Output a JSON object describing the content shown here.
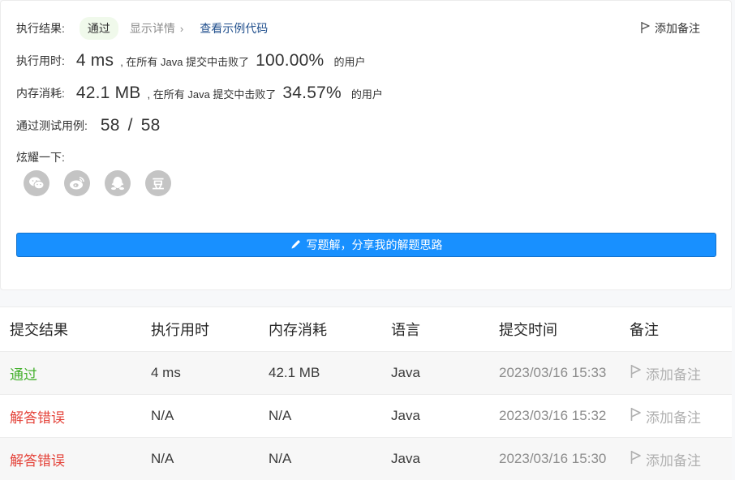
{
  "result": {
    "label": "执行结果:",
    "status": "通过",
    "details_link": "显示详情",
    "details_chevron": "›",
    "example_link": "查看示例代码",
    "add_note": "添加备注"
  },
  "runtime": {
    "label": "执行用时:",
    "value": "4 ms",
    "mid_text": ", 在所有 Java 提交中击败了",
    "percent": "100.00%",
    "suffix": "的用户"
  },
  "memory": {
    "label": "内存消耗:",
    "value": "42.1 MB",
    "mid_text": ", 在所有 Java 提交中击败了",
    "percent": "34.57%",
    "suffix": "的用户"
  },
  "tests": {
    "label": "通过测试用例:",
    "passed": "58",
    "separator": "/",
    "total": "58"
  },
  "share": {
    "label": "炫耀一下:",
    "icons": [
      "wechat-icon",
      "weibo-icon",
      "qq-icon",
      "douban-icon"
    ],
    "douban_glyph": "豆"
  },
  "write_button": "写题解，分享我的解题思路",
  "submissions": {
    "headers": [
      "提交结果",
      "执行用时",
      "内存消耗",
      "语言",
      "提交时间",
      "备注"
    ],
    "rows": [
      {
        "status": "通过",
        "runtime": "4 ms",
        "memory": "42.1 MB",
        "language": "Java",
        "time": "2023/03/16 15:33",
        "note": "添加备注"
      },
      {
        "status": "解答错误",
        "runtime": "N/A",
        "memory": "N/A",
        "language": "Java",
        "time": "2023/03/16 15:32",
        "note": "添加备注"
      },
      {
        "status": "解答错误",
        "runtime": "N/A",
        "memory": "N/A",
        "language": "Java",
        "time": "2023/03/16 15:30",
        "note": "添加备注"
      }
    ]
  },
  "colors": {
    "accent": "#1890ff",
    "success": "#44b02d",
    "error": "#e4443b",
    "link": "#1f4e8c"
  }
}
